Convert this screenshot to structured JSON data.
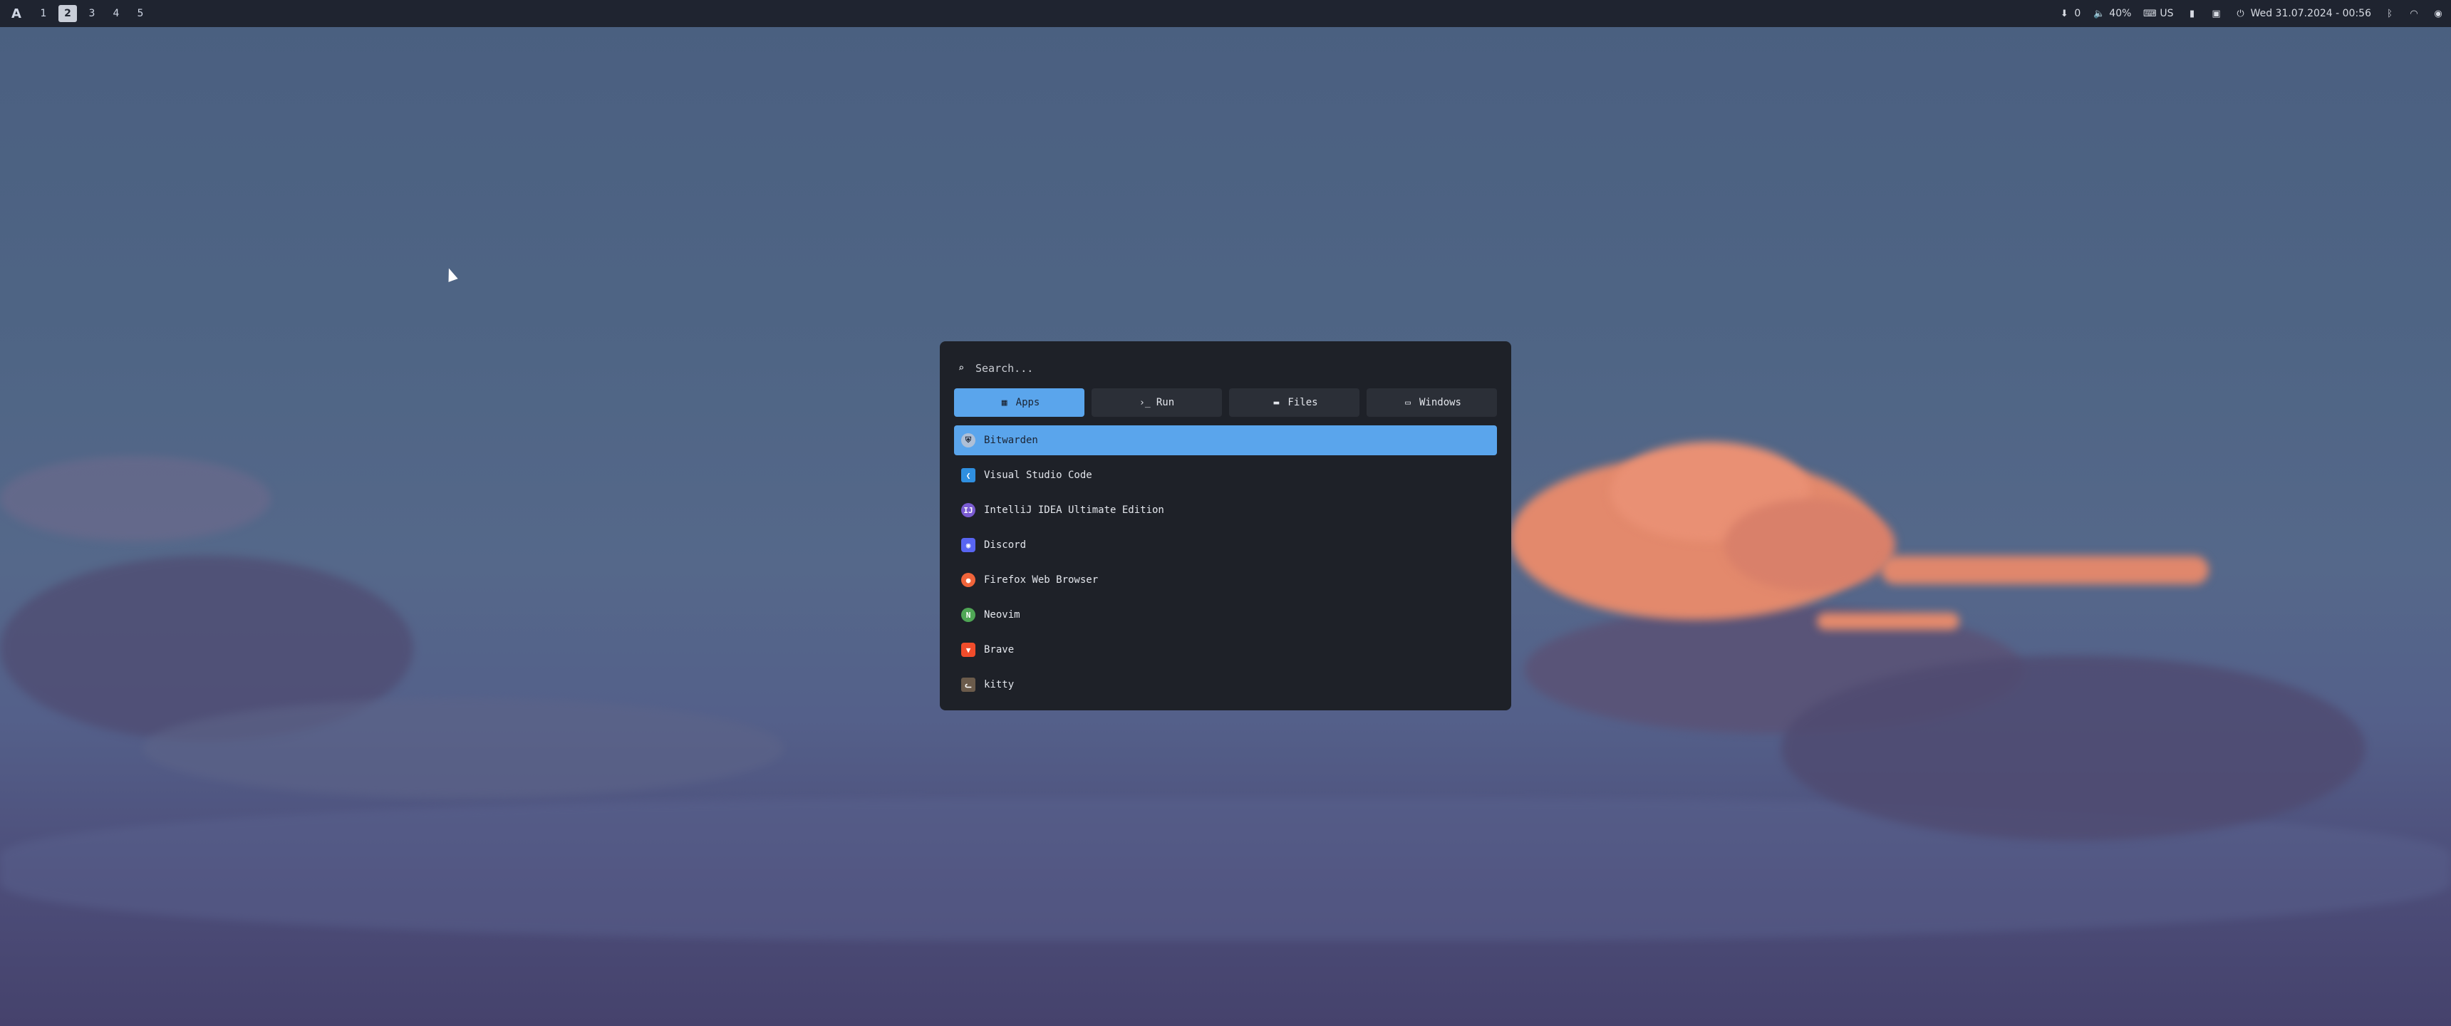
{
  "topbar": {
    "logo": "A",
    "workspaces": [
      "1",
      "2",
      "3",
      "4",
      "5"
    ],
    "active_workspace": "2",
    "tray": {
      "updates": "0",
      "volume": "40%",
      "keyboard": "US",
      "datetime": "Wed 31.07.2024 - 00:56"
    }
  },
  "launcher": {
    "search": {
      "placeholder": "Search...",
      "value": ""
    },
    "tabs": [
      {
        "label": "Apps",
        "icon": "grid-icon"
      },
      {
        "label": "Run",
        "icon": "terminal-icon"
      },
      {
        "label": "Files",
        "icon": "folder-icon"
      },
      {
        "label": "Windows",
        "icon": "window-icon"
      }
    ],
    "active_tab": "Apps",
    "apps": [
      {
        "label": "Bitwarden",
        "color": "#aebfd6"
      },
      {
        "label": "Visual Studio Code",
        "color": "#2f8fe0"
      },
      {
        "label": "IntelliJ IDEA Ultimate Edition",
        "color": "#7a5bd1"
      },
      {
        "label": "Discord",
        "color": "#5865f2"
      },
      {
        "label": "Firefox Web Browser",
        "color": "#f0643a"
      },
      {
        "label": "Neovim",
        "color": "#4fa655"
      },
      {
        "label": "Brave",
        "color": "#f14c2b"
      },
      {
        "label": "kitty",
        "color": "#6b5b4b"
      }
    ],
    "selected_index": 0
  },
  "colors": {
    "accent": "#5aa5ec",
    "launcher_bg": "#1e2128",
    "topbar_bg": "#1f2430"
  }
}
